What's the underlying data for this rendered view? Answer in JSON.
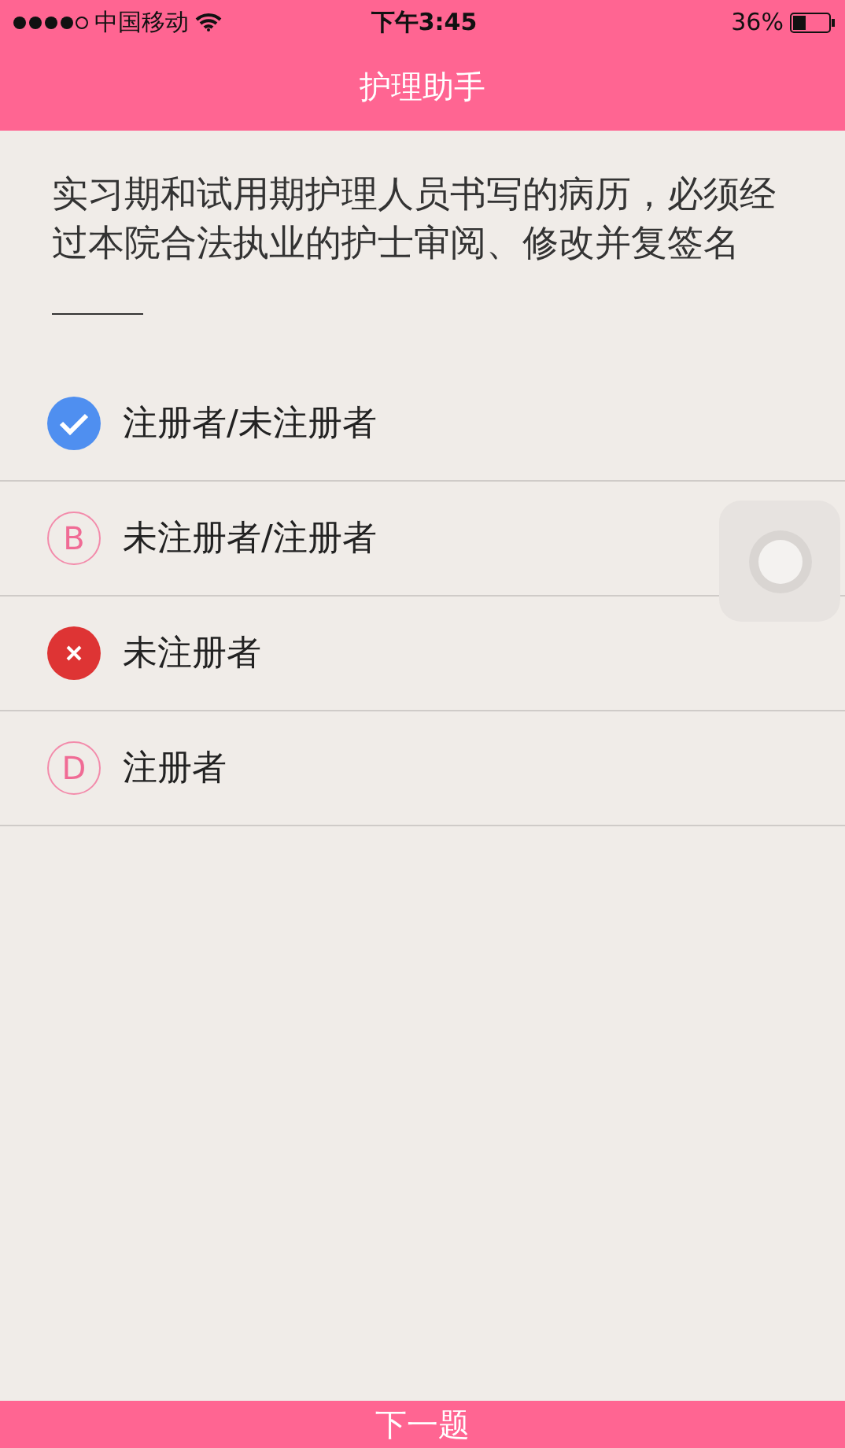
{
  "status_bar": {
    "carrier": "中国移动",
    "time": "下午3:45",
    "battery": "36%"
  },
  "nav_bar": {
    "title": "护理助手"
  },
  "question": {
    "text": "实习期和试用期护理人员书写的病历，必须经过本院合法执业的护士审阅、修改并复签名"
  },
  "options": [
    {
      "kind": "correct",
      "text": "注册者/未注册者"
    },
    {
      "kind": "letter",
      "letter": "B",
      "text": "未注册者/注册者"
    },
    {
      "kind": "wrong",
      "text": "未注册者"
    },
    {
      "kind": "letter",
      "letter": "D",
      "text": "注册者"
    }
  ],
  "next_button": {
    "label": "下一题"
  }
}
